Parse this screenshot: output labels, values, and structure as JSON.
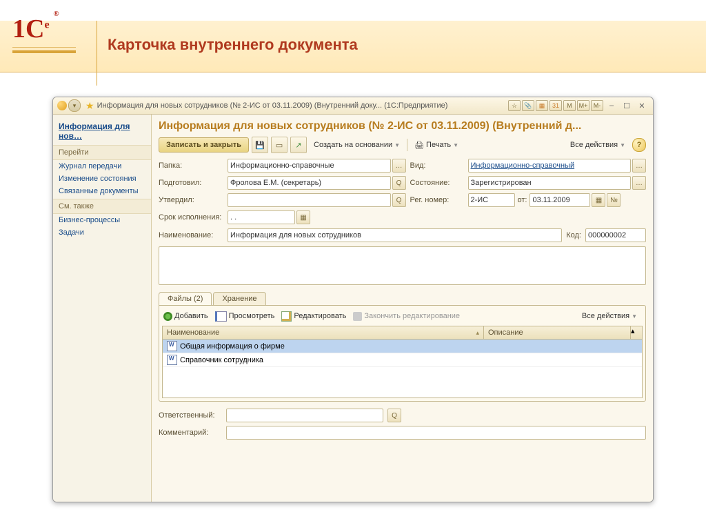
{
  "slide": {
    "title": "Карточка внутреннего документа",
    "logo_text": "1С",
    "logo_e": "e"
  },
  "titlebar": {
    "text": "Информация для новых сотрудников (№ 2-ИС от 03.11.2009) (Внутренний доку...  (1С:Предприятие)",
    "m": "M",
    "mplus": "M+",
    "mminus": "M-"
  },
  "sidebar": {
    "title": "Информация для нов…",
    "goto": "Перейти",
    "links1": [
      "Журнал передачи",
      "Изменение состояния",
      "Связанные документы"
    ],
    "seealso": "См. также",
    "links2": [
      "Бизнес-процессы",
      "Задачи"
    ]
  },
  "main": {
    "title": "Информация для новых сотрудников (№ 2-ИС от 03.11.2009) (Внутренний д...",
    "save_close": "Записать и закрыть",
    "create_based": "Создать на основании",
    "print": "Печать",
    "all_actions": "Все действия",
    "labels": {
      "folder": "Папка:",
      "prepared": "Подготовил:",
      "approved": "Утвердил:",
      "deadline": "Срок исполнения:",
      "kind": "Вид:",
      "state": "Состояние:",
      "regnum": "Рег. номер:",
      "from": "от:",
      "name": "Наименование:",
      "code": "Код:",
      "responsible": "Ответственный:",
      "comment": "Комментарий:",
      "no_btn": "№"
    },
    "values": {
      "folder": "Информационно-справочные",
      "prepared": "Фролова Е.М. (секретарь)",
      "approved": "",
      "deadline": "  .  .",
      "kind": "Информационно-справочный",
      "state": "Зарегистрирован",
      "regnum": "2-ИС",
      "from": "03.11.2009",
      "name": "Информация для новых сотрудников",
      "code": "000000002",
      "responsible": "",
      "comment": ""
    },
    "tabs": {
      "files": "Файлы (2)",
      "storage": "Хранение"
    },
    "filetb": {
      "add": "Добавить",
      "view": "Просмотреть",
      "edit": "Редактировать",
      "finish": "Закончить редактирование",
      "all": "Все действия"
    },
    "filehead": {
      "name": "Наименование",
      "desc": "Описание"
    },
    "files": [
      {
        "name": "Общая информация о фирме",
        "desc": ""
      },
      {
        "name": "Справочник сотрудника",
        "desc": ""
      }
    ]
  }
}
